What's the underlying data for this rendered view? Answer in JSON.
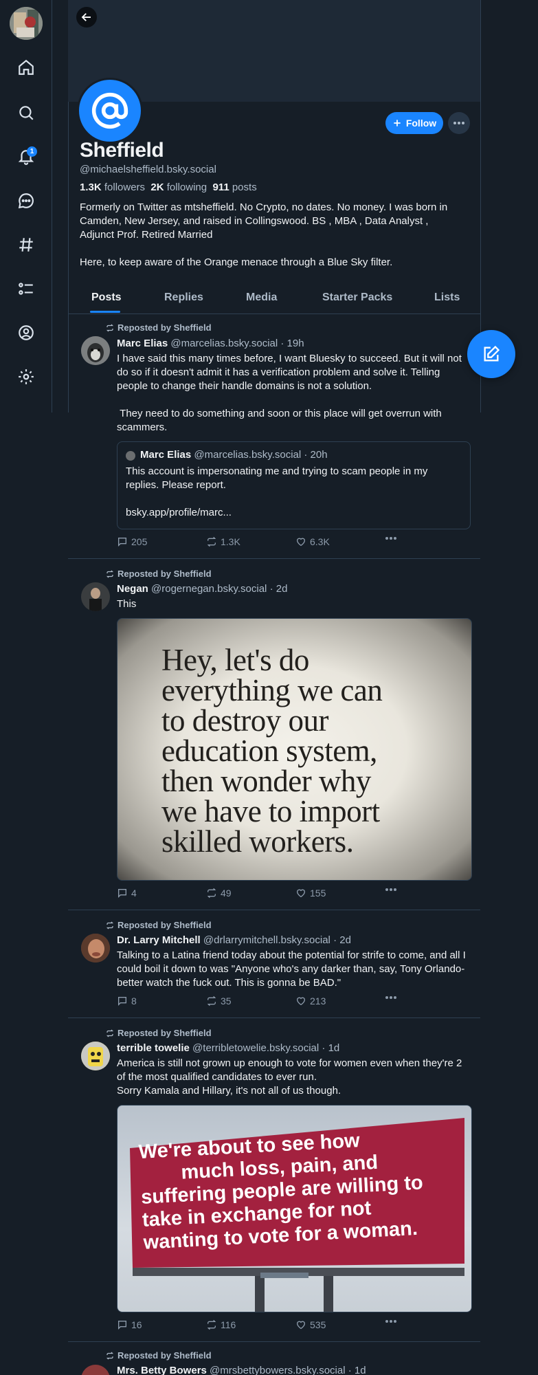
{
  "profile": {
    "display_name": "Sheffield",
    "handle": "@michaelsheffield.bsky.social",
    "followers_count": "1.3K",
    "followers_label": "followers",
    "following_count": "2K",
    "following_label": "following",
    "posts_count": "911",
    "posts_label": "posts",
    "bio_1": "Formerly on Twitter as mtsheffield. No Crypto, no dates. No money. I was born in Camden, New Jersey, and raised in Collingswood.   BS , MBA , Data Analyst , Adjunct Prof. Retired Married",
    "bio_2": "Here, to keep aware of the Orange menace through a Blue Sky filter.",
    "follow_label": "Follow"
  },
  "tabs": [
    "Posts",
    "Replies",
    "Media",
    "Starter Packs",
    "Lists"
  ],
  "sidebar": {
    "items": [
      "home-icon",
      "search-icon",
      "bell-icon",
      "chat-icon",
      "hashtag-icon",
      "list-icon",
      "profile-icon",
      "gear-icon"
    ],
    "notification_badge": "1"
  },
  "colors": {
    "accent": "#1a85ff",
    "background": "#161e27",
    "border": "#2e4052"
  },
  "posts": [
    {
      "reposted_by": "Reposted by Sheffield",
      "author": "Marc Elias",
      "handle": "@marcelias.bsky.social",
      "time": "· 19h",
      "text": "I have said this many times before, I want Bluesky to succeed. But it will not do so if it doesn't admit it has a verification problem and solve it. Telling people to change their handle domains is not a solution.\n\n They need to do something and soon or this place will get overrun with scammers.",
      "quote": {
        "author": "Marc Elias",
        "handle": "@marcelias.bsky.social",
        "time": "· 20h",
        "text": "This account is impersonating me and trying to scam people in my replies. Please report.\n\nbsky.app/profile/marc..."
      },
      "replies": "205",
      "reposts": "1.3K",
      "likes": "6.3K"
    },
    {
      "reposted_by": "Reposted by Sheffield",
      "author": "Negan",
      "handle": "@rogernegan.bsky.social",
      "time": "· 2d",
      "text": "This",
      "image_text": [
        "Hey, let's do",
        "everything we can",
        "to destroy our",
        "education system,",
        "then wonder why",
        "we have to import",
        "skilled workers."
      ],
      "replies": "4",
      "reposts": "49",
      "likes": "155"
    },
    {
      "reposted_by": "Reposted by Sheffield",
      "author": "Dr. Larry Mitchell",
      "handle": "@drlarrymitchell.bsky.social",
      "time": "· 2d",
      "text": "Talking to a Latina friend today about the potential for strife to come, and all I could boil it down to was \"Anyone who's any darker than, say, Tony Orlando- better watch the fuck out. This is gonna be BAD.\"",
      "replies": "8",
      "reposts": "35",
      "likes": "213"
    },
    {
      "reposted_by": "Reposted by Sheffield",
      "author": "terrible towelie",
      "handle": "@terribletowelie.bsky.social",
      "time": "· 1d",
      "text": "America is still not grown up enough to vote for women even when they're 2 of the most qualified candidates to ever run.\nSorry Kamala and Hillary, it's not all of us though.",
      "image_text": [
        "We're about to see how",
        "much loss, pain, and",
        "suffering people are willing to",
        "take in exchange for  not",
        "wanting to vote for a woman."
      ],
      "replies": "16",
      "reposts": "116",
      "likes": "535"
    },
    {
      "reposted_by": "Reposted by Sheffield",
      "author": "Mrs. Betty Bowers",
      "handle": "@mrsbettybowers.bsky.social",
      "time": "· 1d"
    }
  ]
}
